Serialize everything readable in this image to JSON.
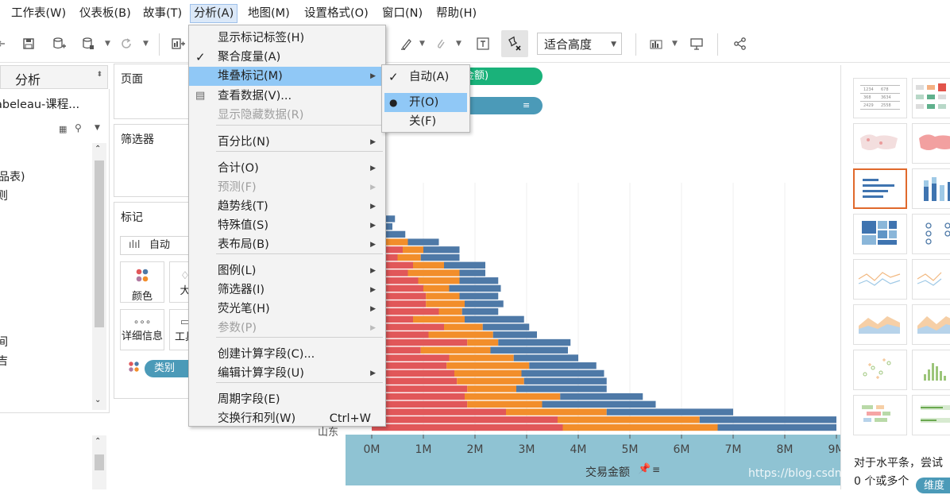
{
  "menubar": {
    "items": [
      "工作表(W)",
      "仪表板(B)",
      "故事(T)",
      "分析(A)",
      "地图(M)",
      "设置格式(O)",
      "窗口(N)",
      "帮助(H)"
    ],
    "active": "分析(A)"
  },
  "toolbar": {
    "fit_select": "适合高度",
    "icons": [
      "undo-icon",
      "save-icon",
      "new-datasource-icon",
      "datasource-icon",
      "refresh-icon",
      "new-sheet-icon",
      "highlight-pen-icon",
      "clip-icon",
      "text-icon",
      "pin-clear-icon",
      "show-me-icon",
      "presentation-icon",
      "share-icon"
    ]
  },
  "left_panel": {
    "header_label": "分析",
    "datasource_label": "abeleau-课程...",
    "fragment_1": "品表)",
    "fragment_2": "则",
    "fragment_3": "间",
    "fragment_4": "吉"
  },
  "shelves": {
    "pages_title": "页面",
    "filters_title": "筛选器",
    "marks_title": "标记",
    "mark_type": "自动",
    "color_label": "颜色",
    "size_label_fragment": "大",
    "detail_label": "详细信息",
    "tooltip_label_fragment": "工具",
    "category_pill": "类别"
  },
  "view": {
    "columns_pill_fragment": "金额)",
    "rows_pill_icon": "sort-icon",
    "row_label_fragment": "山东",
    "x_axis_title": "交易金额",
    "x_axis_ticks": [
      "0M",
      "1M",
      "2M",
      "3M",
      "4M",
      "5M",
      "6M",
      "7M",
      "8M",
      "9M"
    ]
  },
  "showme": {
    "hint_text": "对于水平条，尝试",
    "hint_text_2": "0 个或多个",
    "hint_pill": "维度"
  },
  "analysis_menu": {
    "items": [
      {
        "label": "显示标记标签(H)",
        "checked": false,
        "submenu": false,
        "disabled": false
      },
      {
        "label": "聚合度量(A)",
        "checked": true,
        "submenu": false,
        "disabled": false
      },
      {
        "label": "堆叠标记(M)",
        "checked": false,
        "submenu": true,
        "disabled": false,
        "highlighted": true
      },
      {
        "label": "查看数据(V)...",
        "checked": false,
        "submenu": false,
        "disabled": false,
        "icon": "table-icon"
      },
      {
        "label": "显示隐藏数据(R)",
        "checked": false,
        "submenu": false,
        "disabled": true
      },
      {
        "label": "百分比(N)",
        "checked": false,
        "submenu": true,
        "disabled": false
      },
      {
        "label": "合计(O)",
        "checked": false,
        "submenu": true,
        "disabled": false
      },
      {
        "label": "预测(F)",
        "checked": false,
        "submenu": true,
        "disabled": true
      },
      {
        "label": "趋势线(T)",
        "checked": false,
        "submenu": true,
        "disabled": false
      },
      {
        "label": "特殊值(S)",
        "checked": false,
        "submenu": true,
        "disabled": false
      },
      {
        "label": "表布局(B)",
        "checked": false,
        "submenu": true,
        "disabled": false
      },
      {
        "label": "图例(L)",
        "checked": false,
        "submenu": true,
        "disabled": false
      },
      {
        "label": "筛选器(I)",
        "checked": false,
        "submenu": true,
        "disabled": false
      },
      {
        "label": "荧光笔(H)",
        "checked": false,
        "submenu": true,
        "disabled": false
      },
      {
        "label": "参数(P)",
        "checked": false,
        "submenu": true,
        "disabled": true
      },
      {
        "label": "创建计算字段(C)...",
        "checked": false,
        "submenu": false,
        "disabled": false
      },
      {
        "label": "编辑计算字段(U)",
        "checked": false,
        "submenu": true,
        "disabled": false
      },
      {
        "label": "周期字段(E)",
        "checked": false,
        "submenu": false,
        "disabled": false
      },
      {
        "label": "交换行和列(W)",
        "checked": false,
        "submenu": false,
        "disabled": false,
        "shortcut": "Ctrl+W"
      }
    ]
  },
  "stack_submenu": {
    "items": [
      {
        "label": "自动(A)",
        "mark": "check"
      },
      {
        "label": "开(O)",
        "mark": "dot",
        "highlighted": true
      },
      {
        "label": "关(F)",
        "mark": "none"
      }
    ]
  },
  "watermark": "https://blog.csdn.net/qq_35498049",
  "colors": {
    "series_red": "#e15759",
    "series_orange": "#f28e2b",
    "series_blue": "#4e79a7",
    "pill_green": "#1ab27a",
    "pill_teal": "#4b9ab8",
    "axis_band": "#8fc3d3",
    "menu_highlight": "#90c8f6"
  },
  "chart_data": {
    "type": "bar",
    "orientation": "horizontal",
    "stacked": true,
    "xlabel": "交易金额",
    "xlim": [
      0,
      9
    ],
    "x_unit": "M",
    "series": [
      {
        "values": [
          0,
          0,
          0,
          0,
          0,
          0.1,
          0.6,
          0.5,
          0.8,
          0.7,
          0.9,
          1.0,
          1.05,
          1.05,
          1.3,
          0.8,
          1.4,
          1.1,
          1.85,
          0.95,
          1.5,
          1.45,
          1.6,
          1.65,
          1.85,
          1.8,
          1.85,
          2.6,
          3.6,
          3.7
        ]
      },
      {
        "values": [
          0,
          0.1,
          0.15,
          0.2,
          0.15,
          0.6,
          0.4,
          0.45,
          0.6,
          1.0,
          0.8,
          0.5,
          0.65,
          0.75,
          0.45,
          1.0,
          0.75,
          1.25,
          0.6,
          1.35,
          1.25,
          1.6,
          1.3,
          1.3,
          0.95,
          1.85,
          1.45,
          1.95,
          2.75,
          3.0
        ]
      },
      {
        "values": [
          0.1,
          0.1,
          0.3,
          0.2,
          0.5,
          0.6,
          0.7,
          0.75,
          0.8,
          0.5,
          0.75,
          1.0,
          0.75,
          0.75,
          0.7,
          1.15,
          0.9,
          0.85,
          1.4,
          1.5,
          1.25,
          1.3,
          1.6,
          1.6,
          1.75,
          1.6,
          2.2,
          2.45,
          2.65,
          2.3
        ]
      }
    ]
  }
}
